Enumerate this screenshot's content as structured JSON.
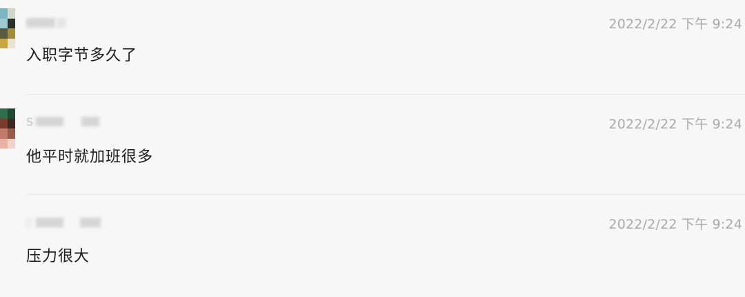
{
  "comments": [
    {
      "username_initial": "",
      "timestamp": "2022/2/22 下午 9:24",
      "text": "入职字节多久了",
      "avatar_colors": [
        "#7fb6c2",
        "#cfd7c9",
        "#2b2f2a",
        "#5a5a3e",
        "#a38b3c",
        "#c9a640",
        "#e9e3d3",
        "#f2efe8"
      ]
    },
    {
      "username_initial": "S",
      "timestamp": "2022/2/22 下午 9:24",
      "text": "他平时就加班很多",
      "avatar_colors": [
        "#2f6e4a",
        "#1f4a32",
        "#7a3a2c",
        "#3b2a22",
        "#c07a6a",
        "#9a5a4a",
        "#e7b1a4",
        "#f1d3cb"
      ]
    },
    {
      "username_initial": "",
      "timestamp": "2022/2/22 下午 9:24",
      "text": "压力很大",
      "avatar_colors": []
    }
  ]
}
